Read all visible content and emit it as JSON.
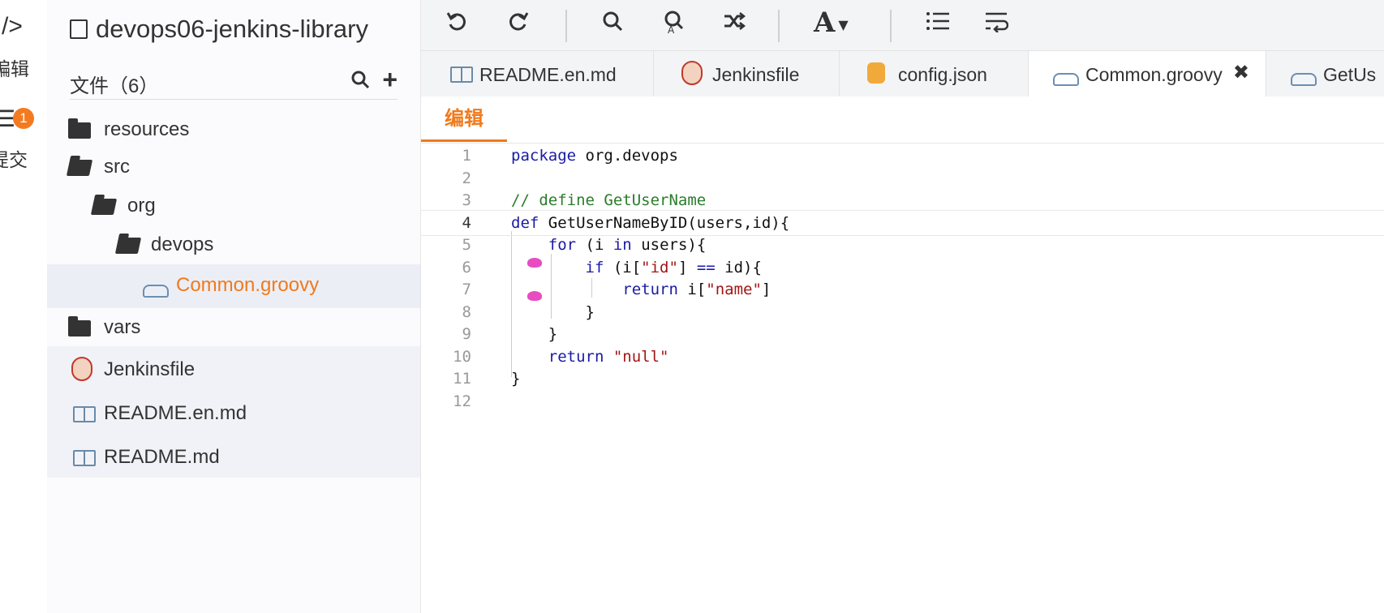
{
  "activity": {
    "code_glyph": "/>",
    "edit_label": "编辑",
    "commit_badge": "1",
    "commit_label": "提交"
  },
  "sidebar": {
    "repo_name": "devops06-jenkins-library",
    "files_label": "文件（6）",
    "tree": [
      {
        "label": "resources",
        "type": "folder"
      },
      {
        "label": "src",
        "type": "folder-open"
      },
      {
        "label": "org",
        "type": "folder-open"
      },
      {
        "label": "devops",
        "type": "folder-open"
      },
      {
        "label": "Common.groovy",
        "type": "groovy",
        "active": true
      },
      {
        "label": "vars",
        "type": "folder"
      },
      {
        "label": "Jenkinsfile",
        "type": "jenkins"
      },
      {
        "label": "README.en.md",
        "type": "book"
      },
      {
        "label": "README.md",
        "type": "book"
      }
    ]
  },
  "toolbar": {
    "undo": "undo-icon",
    "redo": "redo-icon",
    "search": "search-icon",
    "replace": "replace-icon",
    "shuffle": "shuffle-icon",
    "font": "A",
    "list": "list-icon",
    "wrap": "wrap-icon"
  },
  "tabs": [
    {
      "label": "README.en.md",
      "icon": "book-icon"
    },
    {
      "label": "Jenkinsfile",
      "icon": "jenkins-icon"
    },
    {
      "label": "config.json",
      "icon": "database-icon"
    },
    {
      "label": "Common.groovy",
      "icon": "groovy-icon",
      "active": true,
      "close": "✖"
    },
    {
      "label": "GetUs",
      "icon": "groovy-icon"
    }
  ],
  "mode_label": "编辑",
  "editor": {
    "line_numbers": [
      "1",
      "2",
      "3",
      "4",
      "5",
      "6",
      "7",
      "8",
      "9",
      "10",
      "11",
      "12"
    ],
    "current_line": 4
  }
}
